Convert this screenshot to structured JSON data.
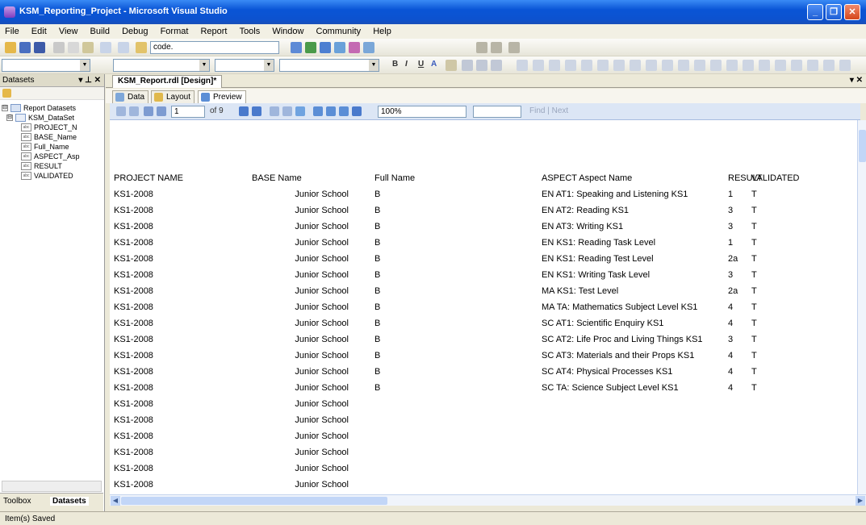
{
  "window": {
    "title": "KSM_Reporting_Project - Microsoft Visual Studio",
    "minimize": "_",
    "maximize": "❐",
    "close": "✕"
  },
  "menu": [
    "File",
    "Edit",
    "View",
    "Build",
    "Debug",
    "Format",
    "Report",
    "Tools",
    "Window",
    "Community",
    "Help"
  ],
  "toolbar": {
    "search_value": "code.",
    "bold": "B",
    "italic": "I",
    "underline": "U",
    "text_a": "A"
  },
  "left_panel": {
    "title": "Datasets",
    "controls": "▾ ⊥ ✕",
    "tree": [
      {
        "label": "Report Datasets",
        "level": 0,
        "expander": "⊟",
        "kind": "root"
      },
      {
        "label": "KSM_DataSet",
        "level": 1,
        "expander": "⊟",
        "kind": "dataset"
      },
      {
        "label": "PROJECT_N",
        "level": 2,
        "kind": "field"
      },
      {
        "label": "BASE_Name",
        "level": 2,
        "kind": "field"
      },
      {
        "label": "Full_Name",
        "level": 2,
        "kind": "field"
      },
      {
        "label": "ASPECT_Asp",
        "level": 2,
        "kind": "field"
      },
      {
        "label": "RESULT",
        "level": 2,
        "kind": "field"
      },
      {
        "label": "VALIDATED",
        "level": 2,
        "kind": "field"
      }
    ],
    "field_icon": "abc",
    "tabs": [
      "Toolbox",
      "Datasets"
    ]
  },
  "document": {
    "tab_label": "KSM_Report.rdl [Design]*",
    "close": "▾ ✕",
    "subtabs": [
      "Data",
      "Layout",
      "Preview"
    ]
  },
  "report_toolbar": {
    "page_value": "1",
    "page_of": "of 9",
    "zoom": "100%",
    "find_next": "Find | Next"
  },
  "report": {
    "headers": [
      "PROJECT NAME",
      "BASE Name",
      "Full Name",
      "ASPECT Aspect Name",
      "RESULT",
      "VALIDATED"
    ],
    "rows": [
      [
        "KS1-2008",
        "Junior School",
        "B",
        "EN AT1: Speaking and Listening KS1",
        "1",
        "T"
      ],
      [
        "KS1-2008",
        "Junior School",
        "B",
        "EN AT2: Reading KS1",
        "3",
        "T"
      ],
      [
        "KS1-2008",
        "Junior School",
        "B",
        "EN AT3: Writing KS1",
        "3",
        "T"
      ],
      [
        "KS1-2008",
        "Junior School",
        "B",
        "EN KS1: Reading Task Level",
        "1",
        "T"
      ],
      [
        "KS1-2008",
        "Junior School",
        "B",
        "EN KS1: Reading Test Level",
        "2a",
        "T"
      ],
      [
        "KS1-2008",
        "Junior School",
        "B",
        "EN KS1: Writing Task Level",
        "3",
        "T"
      ],
      [
        "KS1-2008",
        "Junior School",
        "B",
        "MA KS1: Test Level",
        "2a",
        "T"
      ],
      [
        "KS1-2008",
        "Junior School",
        "B",
        "MA TA: Mathematics Subject Level KS1",
        "4",
        "T"
      ],
      [
        "KS1-2008",
        "Junior School",
        "B",
        "SC AT1: Scientific Enquiry KS1",
        "4",
        "T"
      ],
      [
        "KS1-2008",
        "Junior School",
        "B",
        "SC AT2: Life Proc and Living Things KS1",
        "3",
        "T"
      ],
      [
        "KS1-2008",
        "Junior School",
        "B",
        "SC AT3: Materials and their Props KS1",
        "4",
        "T"
      ],
      [
        "KS1-2008",
        "Junior School",
        "B",
        "SC AT4: Physical Processes KS1",
        "4",
        "T"
      ],
      [
        "KS1-2008",
        "Junior School",
        "B",
        "SC TA: Science Subject Level KS1",
        "4",
        "T"
      ],
      [
        "KS1-2008",
        "Junior School",
        "",
        "",
        "",
        ""
      ],
      [
        "KS1-2008",
        "Junior School",
        "",
        "",
        "",
        ""
      ],
      [
        "KS1-2008",
        "Junior School",
        "",
        "",
        "",
        ""
      ],
      [
        "KS1-2008",
        "Junior School",
        "",
        "",
        "",
        ""
      ],
      [
        "KS1-2008",
        "Junior School",
        "",
        "",
        "",
        ""
      ],
      [
        "KS1-2008",
        "Junior School",
        "",
        "",
        "",
        ""
      ]
    ]
  },
  "status": "Item(s) Saved"
}
